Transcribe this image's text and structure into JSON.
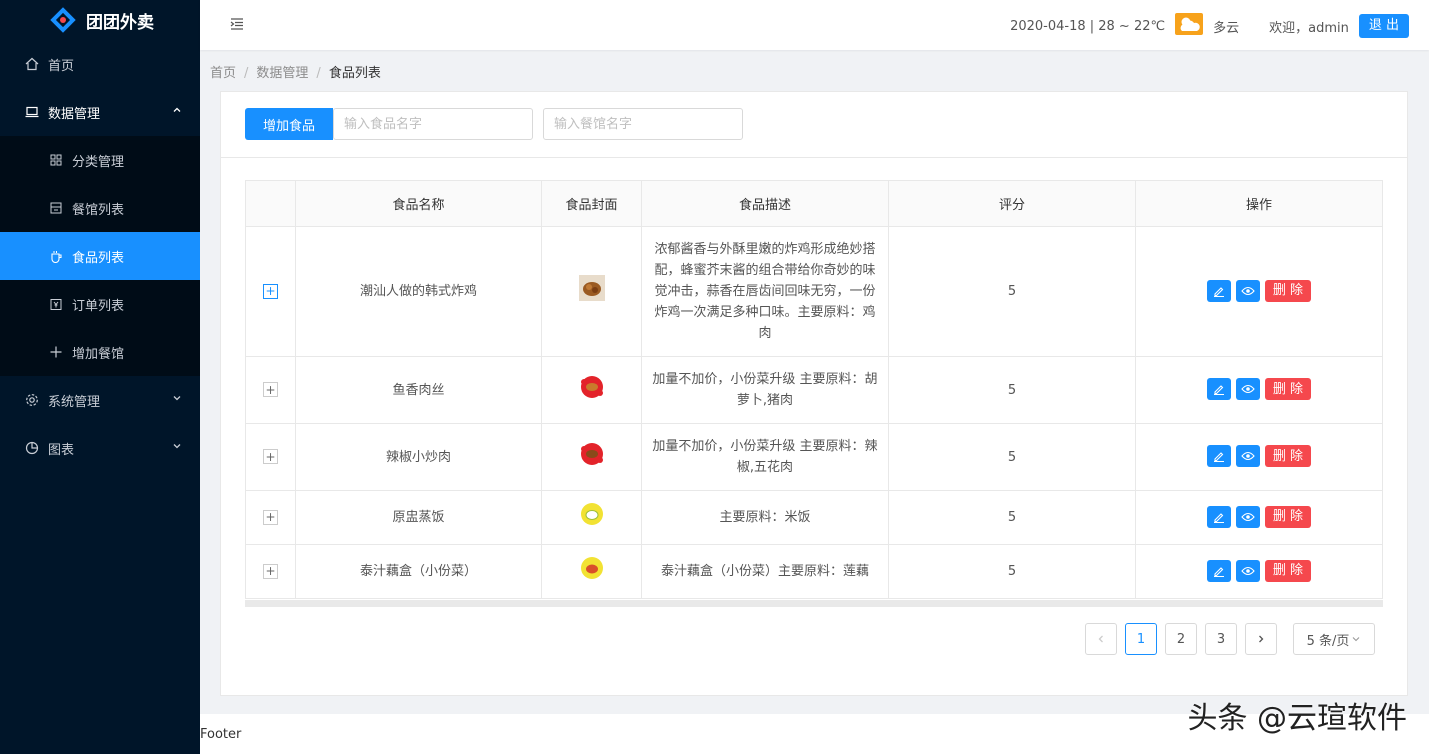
{
  "app": {
    "name": "团团外卖"
  },
  "sidebar": {
    "items": [
      {
        "label": "首页",
        "icon": "home-icon"
      },
      {
        "label": "数据管理",
        "icon": "laptop-icon"
      },
      {
        "label": "分类管理",
        "icon": "grid-icon"
      },
      {
        "label": "餐馆列表",
        "icon": "store-icon"
      },
      {
        "label": "食品列表",
        "icon": "cup-icon"
      },
      {
        "label": "订单列表",
        "icon": "order-icon"
      },
      {
        "label": "增加餐馆",
        "icon": "plus-icon"
      },
      {
        "label": "系统管理",
        "icon": "gear-icon"
      },
      {
        "label": "图表",
        "icon": "pie-chart-icon"
      }
    ]
  },
  "header": {
    "weather": "2020-04-18 | 28 ~ 22℃",
    "weather_desc": "多云",
    "welcome": "欢迎，admin",
    "logout": "退 出"
  },
  "breadcrumb": {
    "home": "首页",
    "section": "数据管理",
    "current": "食品列表"
  },
  "toolbar": {
    "add_label": "增加食品",
    "food_placeholder": "输入食品名字",
    "restaurant_placeholder": "输入餐馆名字"
  },
  "table": {
    "headers": {
      "name": "食品名称",
      "cover": "食品封面",
      "desc": "食品描述",
      "rating": "评分",
      "ops": "操作"
    },
    "delete_label": "删 除",
    "rows": [
      {
        "name": "潮汕人做的韩式炸鸡",
        "desc": "浓郁酱香与外酥里嫩的炸鸡形成绝妙搭配，蜂蜜芥末酱的组合带给你奇妙的味觉冲击，蒜香在唇齿间回味无穷，一份炸鸡一次满足多种口味。主要原料：鸡肉",
        "rating": "5"
      },
      {
        "name": "鱼香肉丝",
        "desc": "加量不加价，小份菜升级 主要原料：胡萝卜,猪肉",
        "rating": "5"
      },
      {
        "name": "辣椒小炒肉",
        "desc": "加量不加价，小份菜升级 主要原料：辣椒,五花肉",
        "rating": "5"
      },
      {
        "name": "原盅蒸饭",
        "desc": "主要原料：米饭",
        "rating": "5"
      },
      {
        "name": "泰汁藕盒（小份菜）",
        "desc": "泰汁藕盒（小份菜）主要原料：莲藕",
        "rating": "5"
      }
    ]
  },
  "pagination": {
    "pages": [
      "1",
      "2",
      "3"
    ],
    "current": "1",
    "size": "5 条/页"
  },
  "footer": {
    "text": "Footer"
  },
  "watermark": {
    "text": "头条 @云瑄软件"
  }
}
